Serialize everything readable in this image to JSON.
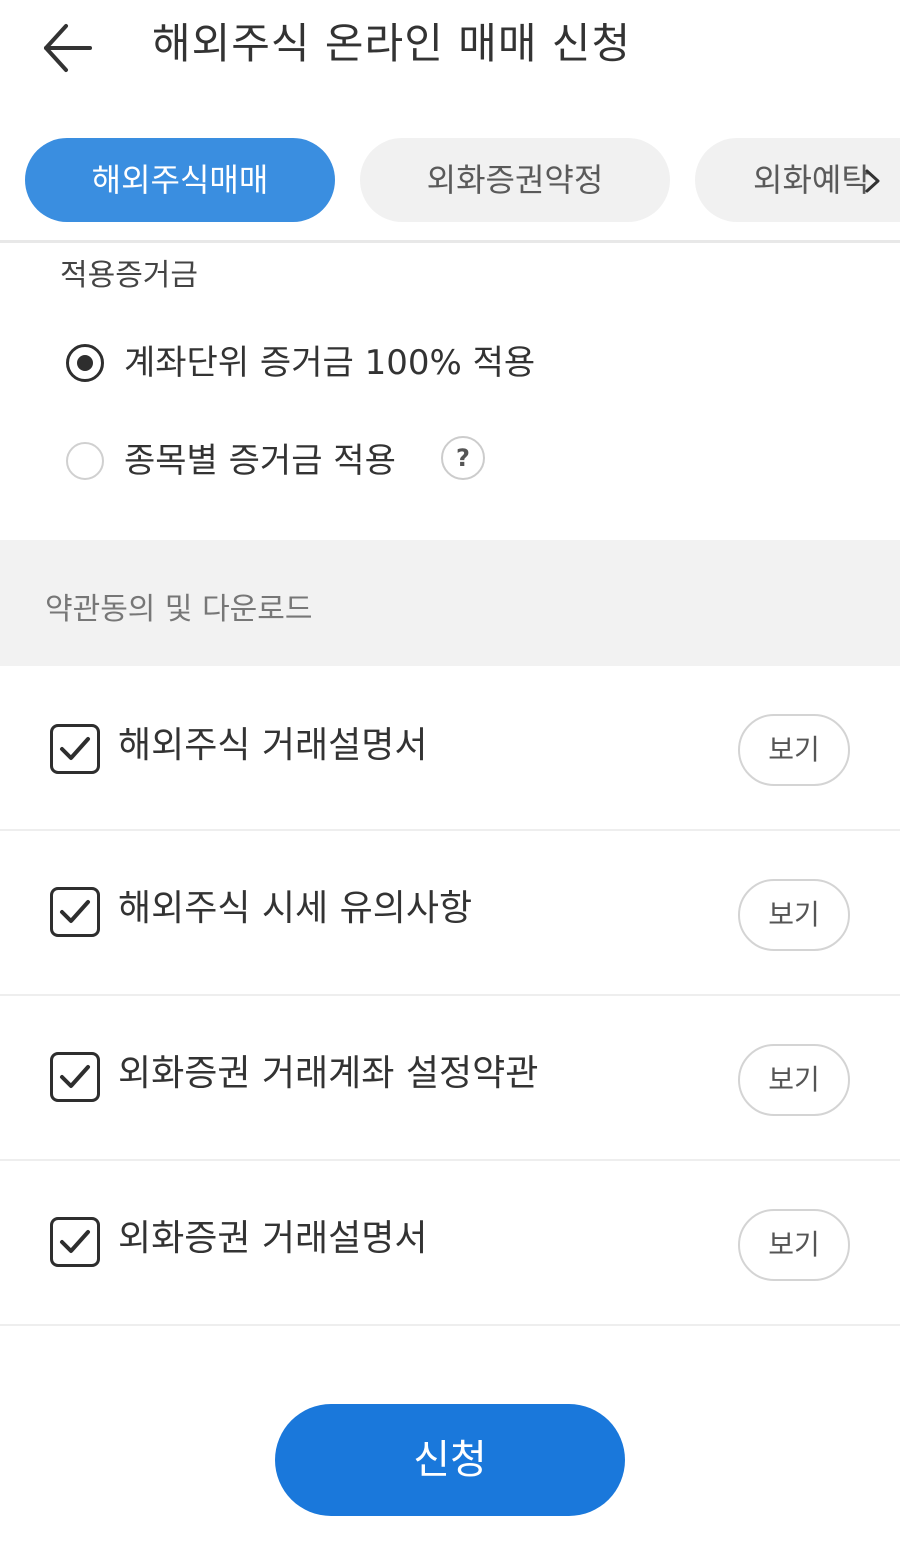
{
  "header": {
    "title": "해외주식 온라인 매매 신청",
    "back_icon": "arrow-left-icon"
  },
  "tabs": [
    {
      "label": "해외주식매매",
      "active": true
    },
    {
      "label": "외화증권약정",
      "active": false
    },
    {
      "label": "외화예탁",
      "active": false
    }
  ],
  "margin": {
    "label": "적용증거금",
    "options": [
      {
        "label": "계좌단위 증거금 100% 적용",
        "selected": true
      },
      {
        "label": "종목별 증거금 적용",
        "selected": false
      }
    ],
    "help_text": "?"
  },
  "terms": {
    "section_title": "약관동의 및 다운로드",
    "items": [
      {
        "label": "해외주식 거래설명서",
        "checked": true,
        "view_label": "보기"
      },
      {
        "label": "해외주식 시세 유의사항",
        "checked": true,
        "view_label": "보기"
      },
      {
        "label": "외화증권 거래계좌 설정약관",
        "checked": true,
        "view_label": "보기"
      },
      {
        "label": "외화증권 거래설명서",
        "checked": true,
        "view_label": "보기"
      }
    ]
  },
  "submit": {
    "label": "신청"
  },
  "colors": {
    "primary": "#1a78db",
    "active_tab": "#3a8ee0",
    "section_bg": "#f2f2f2"
  }
}
